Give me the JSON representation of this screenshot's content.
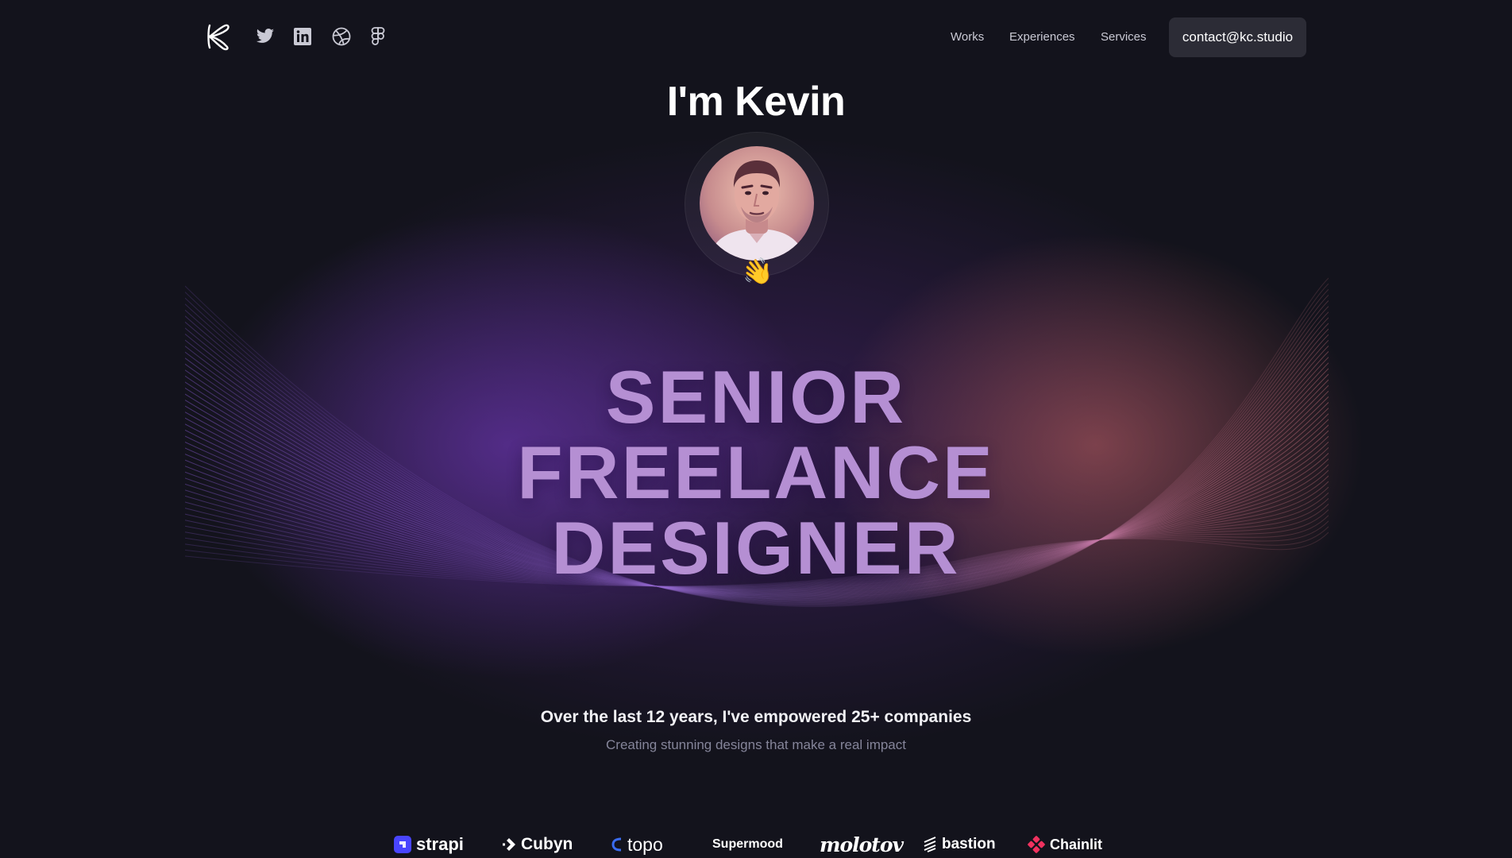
{
  "nav": {
    "logo_icon": "k-logo-icon",
    "social": [
      {
        "name": "twitter-icon"
      },
      {
        "name": "linkedin-icon"
      },
      {
        "name": "dribbble-icon"
      },
      {
        "name": "figma-icon"
      }
    ],
    "links": [
      "Works",
      "Experiences",
      "Services"
    ],
    "contact": "contact@kc.studio"
  },
  "hero": {
    "greeting": "I'm Kevin",
    "avatar_icon": "profile-photo",
    "emoji": "👋",
    "headline": [
      "SENIOR",
      "FREELANCE",
      "DESIGNER"
    ],
    "subtitle": "Over the last 12 years, I've empowered 25+ companies",
    "tagline": "Creating stunning designs that make a real impact"
  },
  "clients": [
    "strapi",
    "Cubyn",
    "topo",
    "Supermood",
    "molotov",
    "bastion",
    "Chainlit"
  ],
  "colors": {
    "background": "#13131c",
    "headline": "#b58fd3",
    "button_bg": "#2c2c36",
    "glow_purple": "#783cc8",
    "glow_coral": "#c86464"
  }
}
